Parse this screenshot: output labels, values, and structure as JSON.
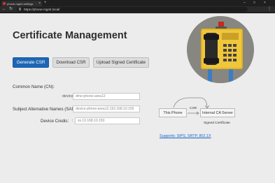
{
  "browser": {
    "tab_title": "phone-mgmt.settings",
    "url": "https://phone-mgmt.local/"
  },
  "page": {
    "title": "Certificate Management"
  },
  "buttons": {
    "generate": "Generate CSR",
    "download": "Download CSR",
    "upload": "Upload Signed Certificate"
  },
  "form": {
    "common_name": {
      "label": "Common Name (CN):",
      "prefix": "device",
      "value": "dme-phone-area12"
    },
    "san": {
      "label": "Subject Alternative Names (SAN):",
      "value": "device-phone-area12,192.168.10.150"
    },
    "device_creds": {
      "label": "Device Credis:",
      "prefix": ":",
      "value": "ss.13.168.10.150"
    }
  },
  "diagram": {
    "source": "This Phone",
    "target": "Internal CA Server",
    "arrow_label": "CSR",
    "return_label": "Signed Certificate"
  },
  "footer_link": "Supports: SIPS, SRTP, 802.1X",
  "colors": {
    "primary": "#1e66b5",
    "link": "#1a63c9"
  }
}
